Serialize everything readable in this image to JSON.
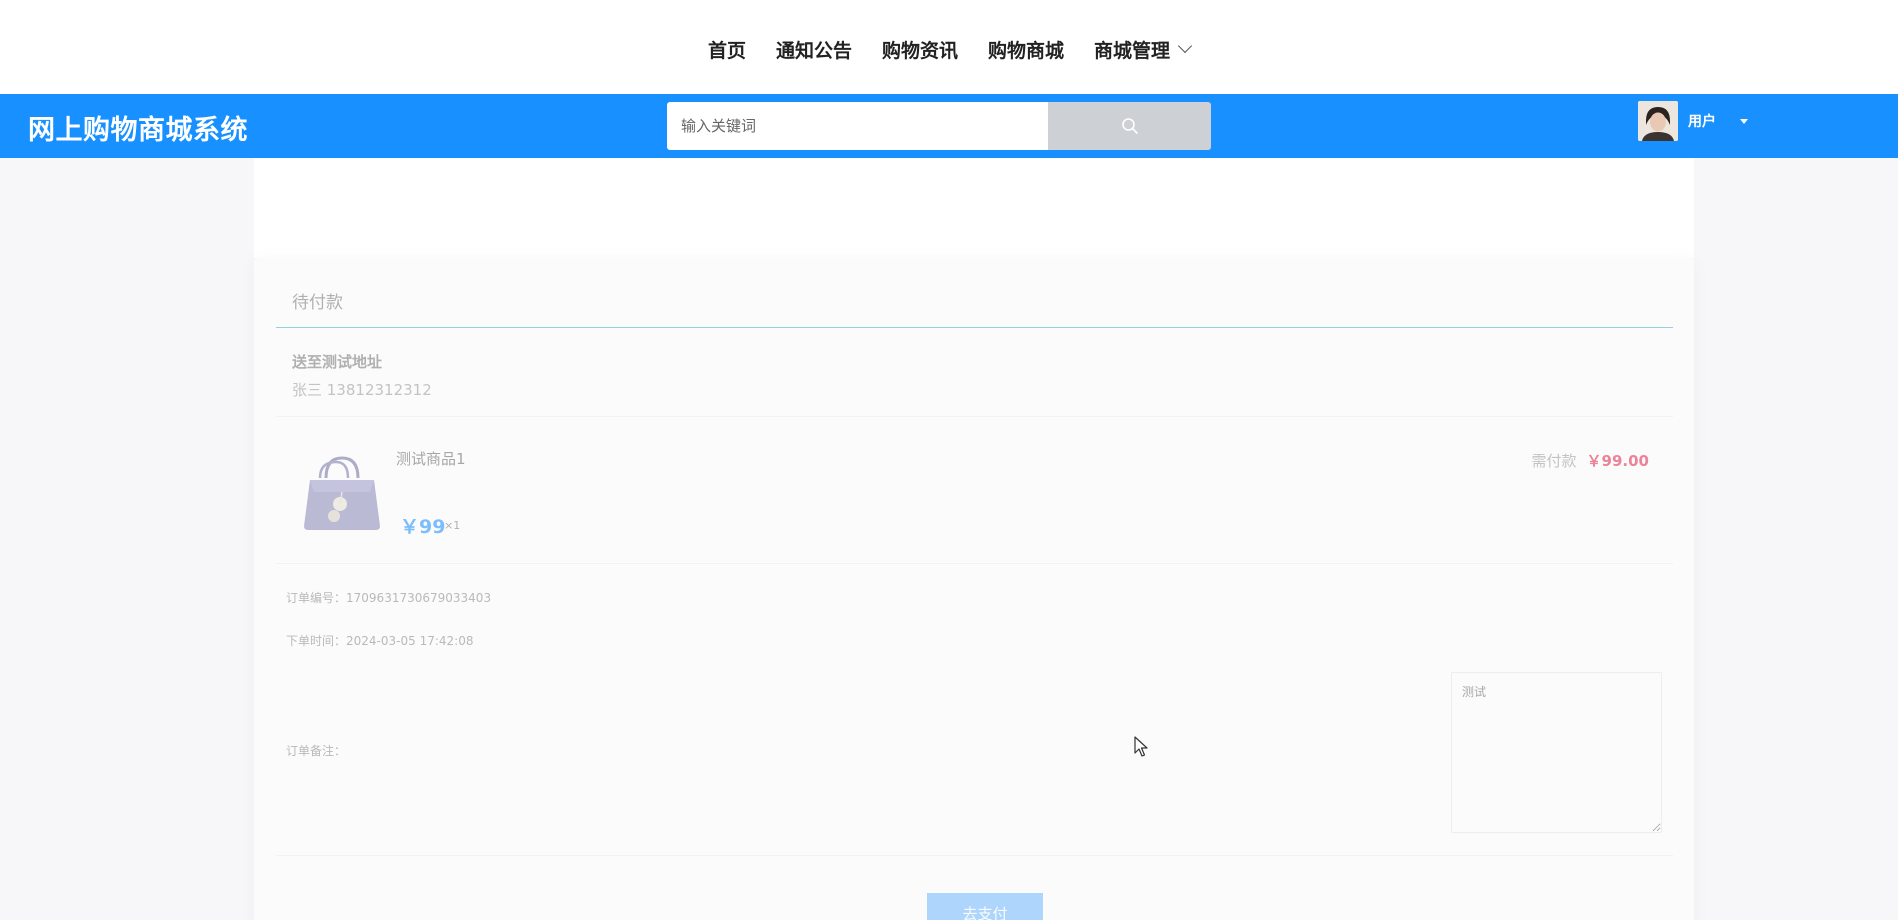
{
  "topnav": {
    "items": [
      {
        "label": "首页"
      },
      {
        "label": "通知公告"
      },
      {
        "label": "购物资讯"
      },
      {
        "label": "购物商城"
      },
      {
        "label": "商城管理",
        "has_dropdown": true
      }
    ]
  },
  "header": {
    "brand": "网上购物商城系统",
    "search_placeholder": "输入关键词",
    "search_icon": "search-icon",
    "user_label": "用户",
    "colors": {
      "primary": "#1890ff",
      "search_button": "#cdd1d5"
    }
  },
  "order": {
    "status": "待付款",
    "address_title": "送至测试地址",
    "recipient": "张三 13812312312",
    "product": {
      "name": "测试商品1",
      "price": "￥99",
      "quantity": "×1"
    },
    "due_label": "需付款",
    "due_amount": "￥99.00",
    "order_no_label": "订单编号：",
    "order_no": "1709631730679033403",
    "order_time_label": "下单时间：",
    "order_time": "2024-03-05 17:42:08",
    "remark_label": "订单备注：",
    "remark_value": "测试",
    "pay_button": "去支付"
  }
}
